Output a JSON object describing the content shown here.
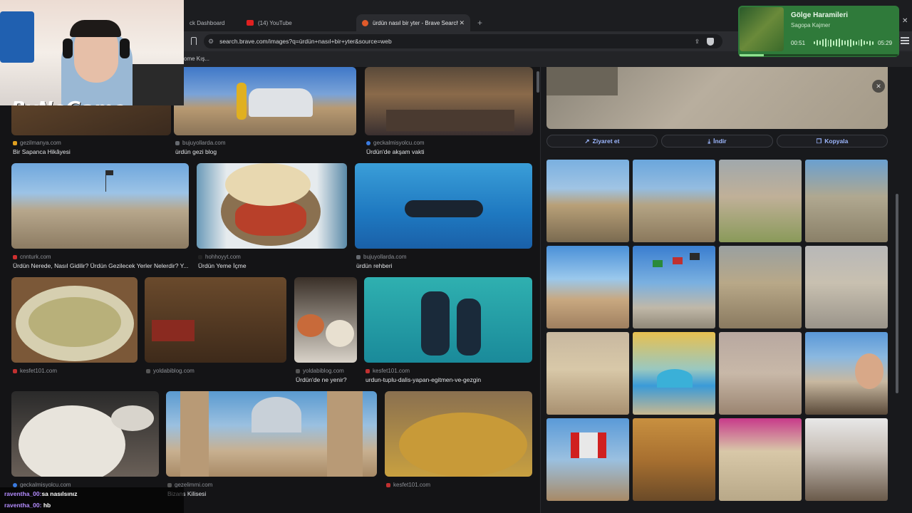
{
  "tabs": [
    {
      "label": "ck Dashboard"
    },
    {
      "label": "(14) YouTube"
    },
    {
      "label": "ürdün nasıl bir yter - Brave Search",
      "active": true
    }
  ],
  "new_tab_symbol": "+",
  "url": "search.brave.com/images?q=ürdün+nasıl+bir+yter&source=web",
  "bookmark": "ome Kış...",
  "results": [
    {
      "source": "gezilmanya.com",
      "caption": "Bir Sapanca Hikâyesi",
      "src_color": "#e0a020"
    },
    {
      "source": "bujuyollarda.com",
      "caption": "ürdün gezi blog",
      "src_color": "#666a70"
    },
    {
      "source": "geckalmisyolcu.com",
      "caption": "Ürdün'de akşam vakti",
      "src_color": "#3a7be0"
    },
    {
      "source": "cnnturk.com",
      "caption": "Ürdün Nerede, Nasıl Gidilir? Ürdün Gezilecek Yerler Nelerdir? Y...",
      "src_color": "#d03030"
    },
    {
      "source": "hohhoyyt.com",
      "caption": "Ürdün Yeme İçme",
      "src_color": "#222222"
    },
    {
      "source": "bujuyollarda.com",
      "caption": "ürdün rehberi",
      "src_color": "#666a70"
    },
    {
      "source": "kesfet101.com",
      "caption": "",
      "src_color": "#c03030"
    },
    {
      "source": "yoldabiblog.com",
      "caption": "",
      "src_color": "#555555"
    },
    {
      "source": "yoldabiblog.com",
      "caption": "Ürdün'de ne yenir?",
      "src_color": "#555555"
    },
    {
      "source": "kesfet101.com",
      "caption": "urdun-tuplu-dalis-yapan-egitmen-ve-gezgin",
      "src_color": "#c03030"
    },
    {
      "source": "geckalmisyolcu.com",
      "caption": "",
      "src_color": "#3a7be0"
    },
    {
      "source": "gezelimmi.com",
      "caption": "Bizans Kilisesi",
      "src_color": "#555555"
    },
    {
      "source": "kesfet101.com",
      "caption": "",
      "src_color": "#c03030"
    }
  ],
  "actions": {
    "visit": "Ziyaret et",
    "download": "İndir",
    "copy": "Kopyala"
  },
  "webcam": {
    "overlay_logo": "ByNoGame"
  },
  "music": {
    "title": "Gölge Haramileri",
    "artist": "Sagopa Kajmer",
    "elapsed": "00:51",
    "total": "05:29",
    "progress": 0.155
  },
  "chat": [
    {
      "user": "raventha_00:",
      "message": "sa nasılsınız"
    },
    {
      "user": "raventha_00:",
      "message": "hb"
    }
  ],
  "accent_color": "#9db7ff"
}
